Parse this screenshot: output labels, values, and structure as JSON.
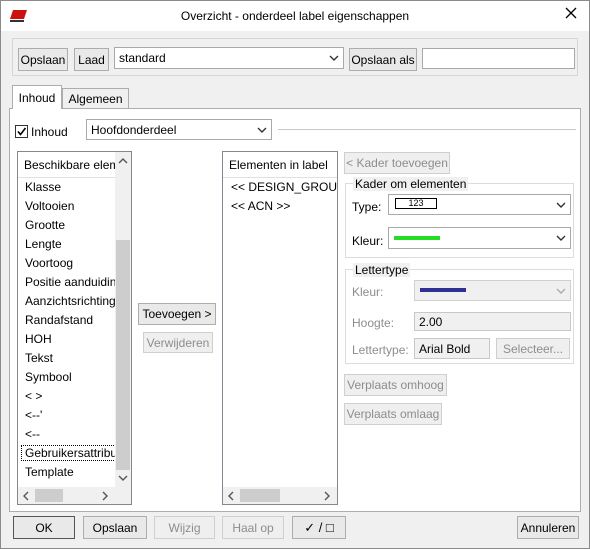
{
  "window": {
    "title": "Overzicht - onderdeel label eigenschappen"
  },
  "toolbar": {
    "save_label": "Opslaan",
    "load_label": "Laad",
    "preset_value": "standard",
    "save_as_label": "Opslaan als",
    "save_as_value": ""
  },
  "tabs": [
    {
      "label": "Inhoud"
    },
    {
      "label": "Algemeen"
    }
  ],
  "content": {
    "checkbox_label": "Inhoud",
    "checked": true,
    "part_select_value": "Hoofdonderdeel"
  },
  "available": {
    "header": "Beschikbare elem",
    "items": [
      "Klasse",
      "Voltooien",
      "Grootte",
      "Lengte",
      "Voortoog",
      "Positie aanduidin",
      "Aanzichtsrichting",
      "Randafstand",
      "HOH",
      "Tekst",
      "Symbool",
      "<  >",
      "<--'",
      "<--",
      "Gebruikersattribu",
      "Template"
    ],
    "selected_index": 14
  },
  "middle_buttons": {
    "add": "Toevoegen >",
    "remove": "Verwijderen"
  },
  "elements": {
    "header": "Elementen in label",
    "items": [
      "<< DESIGN_GROUP_",
      "<< ACN >>"
    ]
  },
  "frame": {
    "add_button": "< Kader toevoegen",
    "group_title": "Kader om elementen",
    "type_label": "Type:",
    "type_value": "123",
    "color_label": "Kleur:",
    "color": "#22dd22"
  },
  "font": {
    "group_title": "Lettertype",
    "color_label": "Kleur:",
    "color": "#2e3192",
    "height_label": "Hoogte:",
    "height_value": "2.00",
    "type_label": "Lettertype:",
    "type_value": "Arial Bold",
    "select_button": "Selecteer..."
  },
  "move": {
    "up": "Verplaats omhoog",
    "down": "Verplaats omlaag"
  },
  "footer": {
    "ok": "OK",
    "save": "Opslaan",
    "modify": "Wijzig",
    "get": "Haal op",
    "toggle": "✓ / □",
    "cancel": "Annuleren"
  },
  "icons": {
    "app": "label-app-icon",
    "close": "close-icon",
    "dropdown": "chevron-down-icon"
  }
}
